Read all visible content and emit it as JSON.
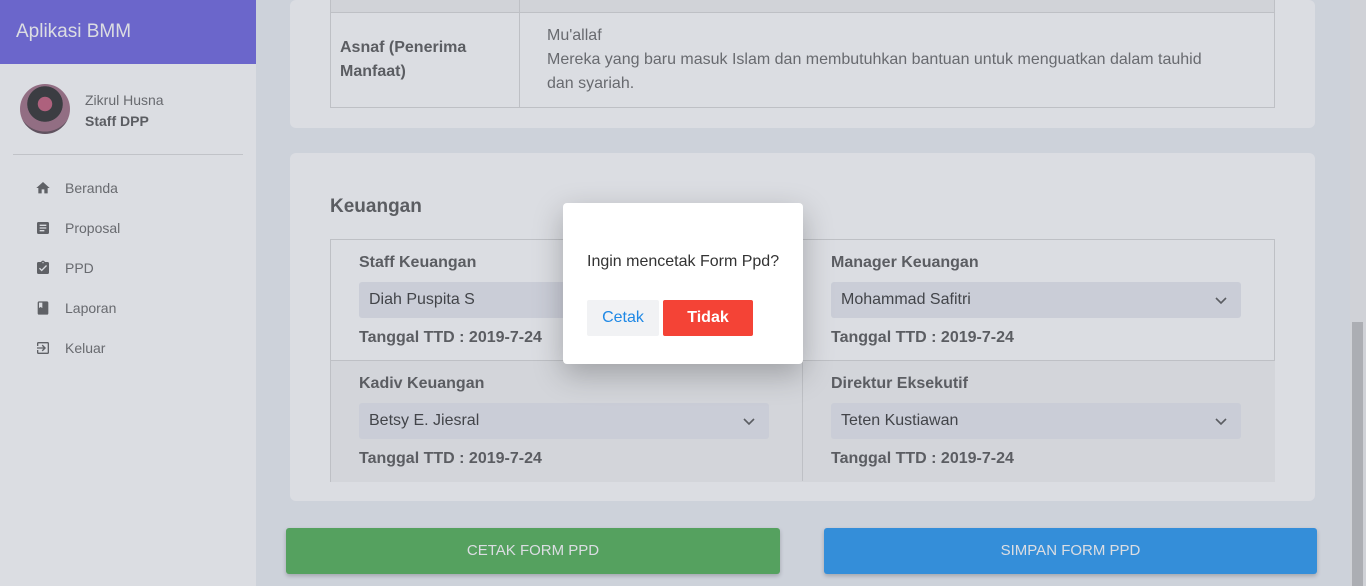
{
  "app": {
    "title": "Aplikasi BMM"
  },
  "user": {
    "name": "Zikrul Husna",
    "role": "Staff DPP"
  },
  "menu": [
    {
      "label": "Beranda",
      "icon": "home-icon"
    },
    {
      "label": "Proposal",
      "icon": "document-icon"
    },
    {
      "label": "PPD",
      "icon": "clipboard-check-icon"
    },
    {
      "label": "Laporan",
      "icon": "book-icon"
    },
    {
      "label": "Keluar",
      "icon": "logout-icon"
    }
  ],
  "asnaf": {
    "label": "Asnaf (Penerima Manfaat)",
    "name": "Mu'allaf",
    "description": "Mereka yang baru masuk Islam dan membutuhkan bantuan untuk menguatkan dalam tauhid dan syariah."
  },
  "keuangan": {
    "title": "Keuangan",
    "signers": [
      {
        "role": "Staff Keuangan",
        "selected": "Diah Puspita S",
        "date": "Tanggal TTD : 2019-7-24"
      },
      {
        "role": "Manager Keuangan",
        "selected": "Mohammad Safitri",
        "date": "Tanggal TTD : 2019-7-24"
      },
      {
        "role": "Kadiv Keuangan",
        "selected": "Betsy E. Jiesral",
        "date": "Tanggal TTD : 2019-7-24"
      },
      {
        "role": "Direktur Eksekutif",
        "selected": "Teten Kustiawan",
        "date": "Tanggal TTD : 2019-7-24"
      }
    ]
  },
  "actions": {
    "cetak_form": "CETAK FORM PPD",
    "simpan_form": "SIMPAN FORM PPD"
  },
  "dialog": {
    "message": "Ingin mencetak Form Ppd?",
    "confirm": "Cetak",
    "cancel": "Tidak"
  },
  "colors": {
    "header": "#6a60e0",
    "print_button": "#4caf50",
    "save_button": "#2196f3",
    "cancel_button": "#f44336",
    "confirm_text": "#1e88e5"
  }
}
